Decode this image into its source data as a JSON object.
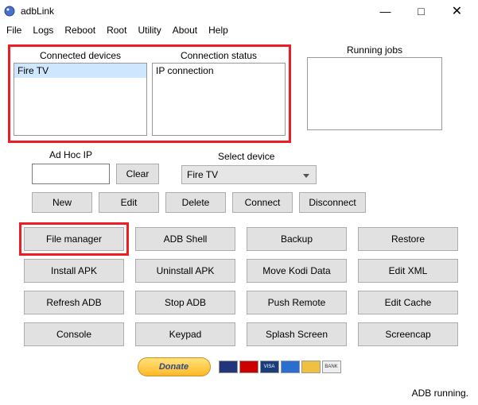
{
  "window": {
    "title": "adbLink",
    "controls": {
      "min": "—",
      "max": "□",
      "close": "✕"
    }
  },
  "menu": [
    "File",
    "Logs",
    "Reboot",
    "Root",
    "Utility",
    "About",
    "Help"
  ],
  "panels": {
    "connected_label": "Connected devices",
    "status_label": "Connection status",
    "running_label": "Running jobs",
    "device_item": "Fire TV",
    "status_item": "IP connection"
  },
  "row2": {
    "adhoc_label": "Ad Hoc IP",
    "adhoc_value": "",
    "clear": "Clear",
    "select_label": "Select device",
    "select_value": "Fire TV"
  },
  "row3": {
    "new": "New",
    "edit": "Edit",
    "delete": "Delete",
    "connect": "Connect",
    "disconnect": "Disconnect"
  },
  "grid": {
    "b1": "File manager",
    "b2": "ADB Shell",
    "b3": "Backup",
    "b4": "Restore",
    "b5": "Install APK",
    "b6": "Uninstall APK",
    "b7": "Move Kodi Data",
    "b8": "Edit XML",
    "b9": "Refresh ADB",
    "b10": "Stop ADB",
    "b11": "Push Remote",
    "b12": "Edit Cache",
    "b13": "Console",
    "b14": "Keypad",
    "b15": "Splash Screen",
    "b16": "Screencap"
  },
  "donate": {
    "label": "Donate"
  },
  "status_text": "ADB running."
}
